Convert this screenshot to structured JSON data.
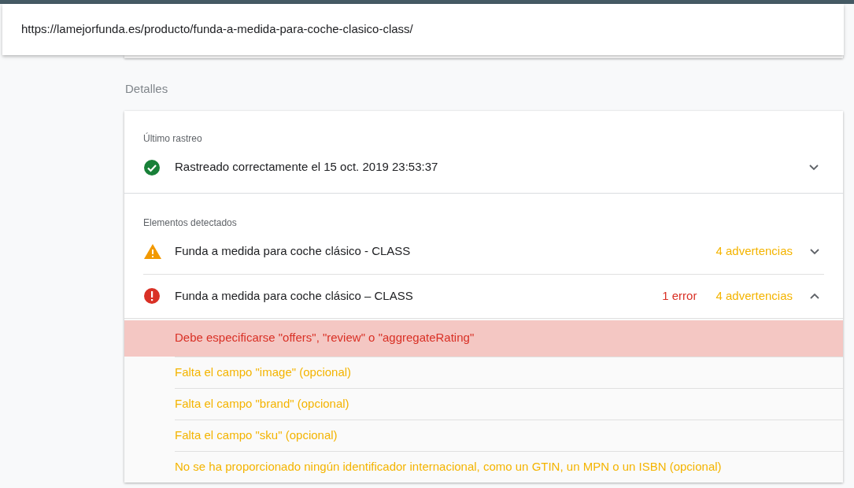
{
  "url": "https://lamejorfunda.es/producto/funda-a-medida-para-coche-clasico-class/",
  "section_title": "Detalles",
  "last_crawl": {
    "label": "Último rastreo",
    "status": "Rastreado correctamente el 15 oct. 2019 23:53:37",
    "expanded": false
  },
  "detected": {
    "label": "Elementos detectados",
    "items": [
      {
        "kind": "warning",
        "name": "Funda a medida para coche clásico - CLASS",
        "warnings": "4 advertencias",
        "expanded": false
      },
      {
        "kind": "error",
        "name": "Funda a medida para coche clásico – CLASS",
        "errors": "1 error",
        "warnings": "4 advertencias",
        "expanded": true,
        "issues": [
          {
            "kind": "error",
            "text": "Debe especificarse \"offers\", \"review\" o \"aggregateRating\""
          },
          {
            "kind": "warning",
            "text": "Falta el campo \"image\" (opcional)"
          },
          {
            "kind": "warning",
            "text": "Falta el campo \"brand\" (opcional)"
          },
          {
            "kind": "warning",
            "text": "Falta el campo \"sku\" (opcional)"
          },
          {
            "kind": "warning",
            "text": "No se ha proporcionado ningún identificador internacional, como un GTIN, un MPN o un ISBN (opcional)"
          }
        ]
      }
    ]
  }
}
